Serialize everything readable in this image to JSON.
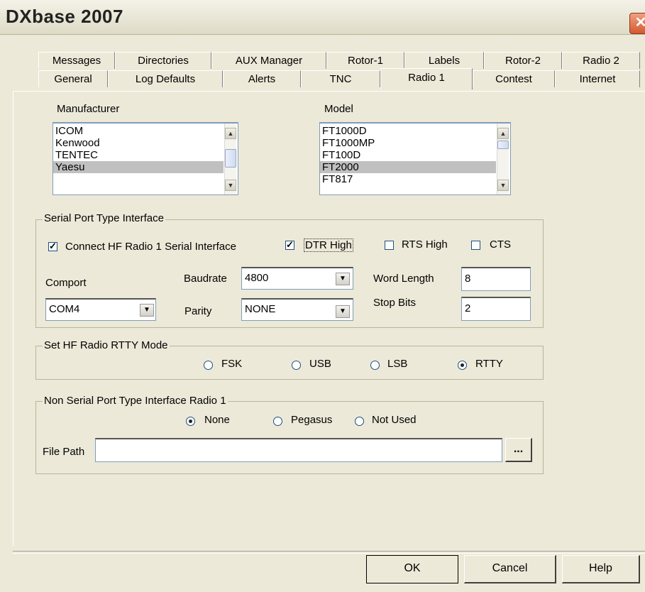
{
  "window": {
    "title": "DXbase 2007",
    "close_icon": "close-icon"
  },
  "tabs_row1": [
    "Messages",
    "Directories",
    "AUX Manager",
    "Rotor-1",
    "Labels",
    "Rotor-2",
    "Radio 2"
  ],
  "tabs_row2": [
    "General",
    "Log Defaults",
    "Alerts",
    "TNC",
    "Radio 1",
    "Contest",
    "Internet"
  ],
  "active_tab": "Radio 1",
  "manufacturer": {
    "label": "Manufacturer",
    "items": [
      "ICOM",
      "Kenwood",
      "TENTEC",
      "Yaesu"
    ],
    "selected": "Yaesu"
  },
  "model": {
    "label": "Model",
    "items": [
      "FT1000D",
      "FT1000MP",
      "FT100D",
      "FT2000",
      "FT817"
    ],
    "selected": "FT2000"
  },
  "serial": {
    "legend": "Serial Port Type Interface",
    "connect_label": "Connect HF Radio 1 Serial Interface",
    "connect_checked": true,
    "dtr_label": "DTR High",
    "dtr_checked": true,
    "rts_label": "RTS High",
    "rts_checked": false,
    "cts_label": "CTS",
    "cts_checked": false,
    "comport_label": "Comport",
    "comport_value": "COM4",
    "baudrate_label": "Baudrate",
    "baudrate_value": "4800",
    "parity_label": "Parity",
    "parity_value": "NONE",
    "word_length_label": "Word Length",
    "word_length_value": "8",
    "stop_bits_label": "Stop Bits",
    "stop_bits_value": "2"
  },
  "rtty": {
    "legend": "Set HF Radio RTTY Mode",
    "options": [
      "FSK",
      "USB",
      "LSB",
      "RTTY"
    ],
    "selected": "RTTY"
  },
  "nonserial": {
    "legend": "Non Serial Port Type Interface Radio 1",
    "options": [
      "None",
      "Pegasus",
      "Not Used"
    ],
    "selected": "None",
    "file_path_label": "File Path",
    "file_path_value": "",
    "browse_label": "..."
  },
  "buttons": {
    "ok": "OK",
    "cancel": "Cancel",
    "help": "Help"
  }
}
